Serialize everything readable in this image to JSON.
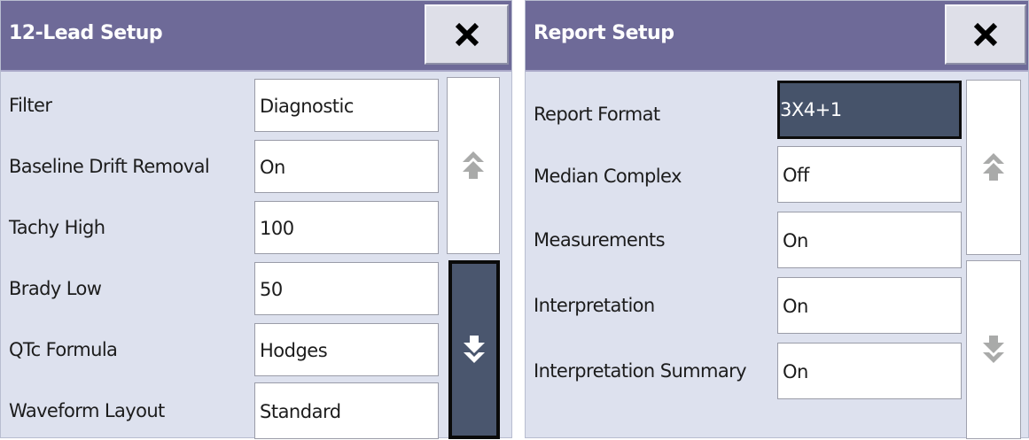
{
  "lead_setup": {
    "title": "12-Lead Setup",
    "close_icon": "x-icon",
    "rows": [
      {
        "label": "Filter",
        "value": "Diagnostic"
      },
      {
        "label": "Baseline Drift Removal",
        "value": "On"
      },
      {
        "label": "Tachy High",
        "value": "100"
      },
      {
        "label": "Brady Low",
        "value": "50"
      },
      {
        "label": "QTc Formula",
        "value": "Hodges"
      },
      {
        "label": "Waveform Layout",
        "value": "Standard"
      }
    ],
    "scroll_up_icon": "scroll-up-arrow-icon",
    "scroll_down_icon": "scroll-down-arrow-icon"
  },
  "report_setup": {
    "title": "Report Setup",
    "close_icon": "x-icon",
    "rows": [
      {
        "label": "Report Format",
        "value": "3X4+1"
      },
      {
        "label": "Median Complex",
        "value": "Off"
      },
      {
        "label": "Measurements",
        "value": "On"
      },
      {
        "label": "Interpretation",
        "value": "On"
      },
      {
        "label": "Interpretation Summary",
        "value": "On"
      }
    ],
    "scroll_up_icon": "scroll-up-arrow-icon",
    "scroll_down_icon": "scroll-down-arrow-icon"
  },
  "colors": {
    "titlebar": "#6e6a98",
    "panel_bg": "#dde1ee",
    "selected_bg": "#46536a",
    "disabled_arrow": "#a9aaa9"
  }
}
